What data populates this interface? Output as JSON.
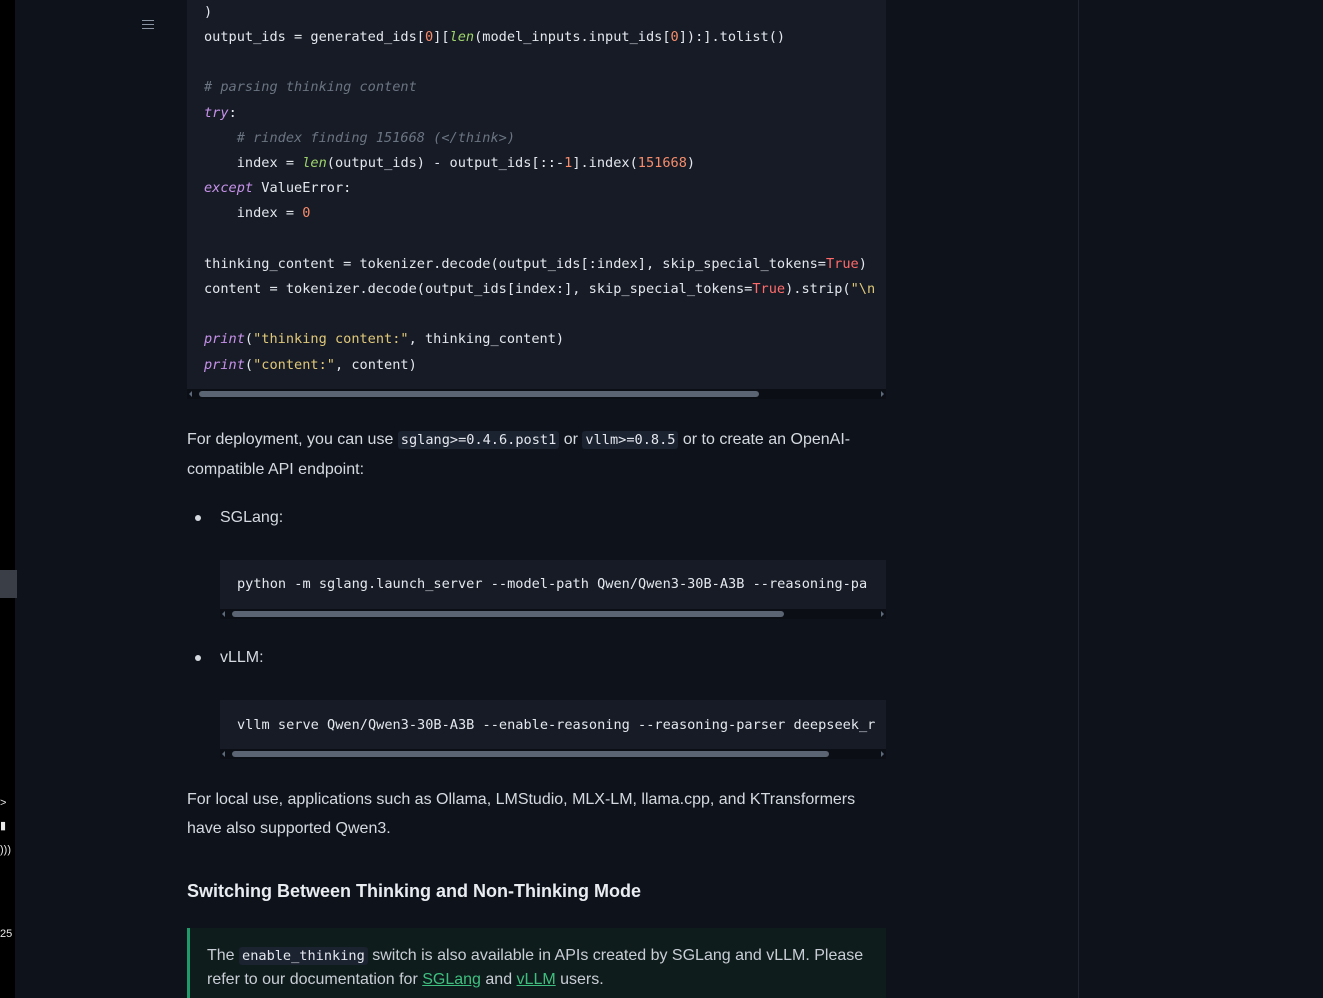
{
  "colors": {
    "page_bg": "#0e131b",
    "code_bg": "#161b25",
    "keyword": "#c792ea",
    "function": "#9fd46c",
    "string": "#e0c87a",
    "number": "#f78c6c",
    "comment": "#6b7482",
    "boolean": "#ff6b6b",
    "link": "#3fbf7f",
    "note_border": "#1f9b6b"
  },
  "sidebar": {
    "menu_icon": "hamburger-menu-icon",
    "strip_glyphs": [
      ">",
      "▮",
      ")))",
      "25"
    ]
  },
  "code_main": {
    "l1": ")",
    "l2a": "output_ids = generated_ids[",
    "l2b": "0",
    "l2c": "][",
    "l2d": "len",
    "l2e": "(model_inputs.input_ids[",
    "l2f": "0",
    "l2g": "]):].tolist()",
    "l3": "# parsing thinking content",
    "l4a": "try",
    "l4b": ":",
    "l5": "    # rindex finding 151668 (</think>)",
    "l6a": "    index = ",
    "l6b": "len",
    "l6c": "(output_ids) - output_ids[::-",
    "l6d": "1",
    "l6e": "].index(",
    "l6f": "151668",
    "l6g": ")",
    "l7a": "except",
    "l7b": " ValueError:",
    "l8a": "    index = ",
    "l8b": "0",
    "l9a": "thinking_content = tokenizer.decode(output_ids[:index], skip_special_tokens=",
    "l9b": "True",
    "l9c": ")",
    "l10a": "content = tokenizer.decode(output_ids[index:], skip_special_tokens=",
    "l10b": "True",
    "l10c": ").strip(",
    "l10d": "\"\\n",
    "l11a": "print",
    "l11b": "(",
    "l11c": "\"thinking content:\"",
    "l11d": ", thinking_content)",
    "l12a": "print",
    "l12b": "(",
    "l12c": "\"content:\"",
    "l12d": ", content)"
  },
  "deploy_para": {
    "t1": "For deployment, you can use ",
    "c1": "sglang>=0.4.6.post1",
    "t2": " or ",
    "c2": "vllm>=0.8.5",
    "t3": " or to create an OpenAI-compatible API endpoint:"
  },
  "sglang": {
    "label": "SGLang:",
    "command": "python -m sglang.launch_server --model-path Qwen/Qwen3-30B-A3B --reasoning-pa"
  },
  "vllm": {
    "label": "vLLM:",
    "command": "vllm serve Qwen/Qwen3-30B-A3B --enable-reasoning --reasoning-parser deepseek_r"
  },
  "local_para": "For local use, applications such as Ollama, LMStudio, MLX-LM, llama.cpp, and KTransformers have also supported Qwen3.",
  "section_heading": "Switching Between Thinking and Non-Thinking Mode",
  "note": {
    "t1": "The ",
    "code": "enable_thinking",
    "t2": " switch is also available in APIs created by SGLang and vLLM. Please refer to our documentation for ",
    "link1": "SGLang",
    "t3": " and ",
    "link2": "vLLM",
    "t4": " users."
  },
  "scroll": {
    "main_fraction": 0.83,
    "sglang_fraction": 0.86,
    "vllm_fraction": 0.93
  }
}
